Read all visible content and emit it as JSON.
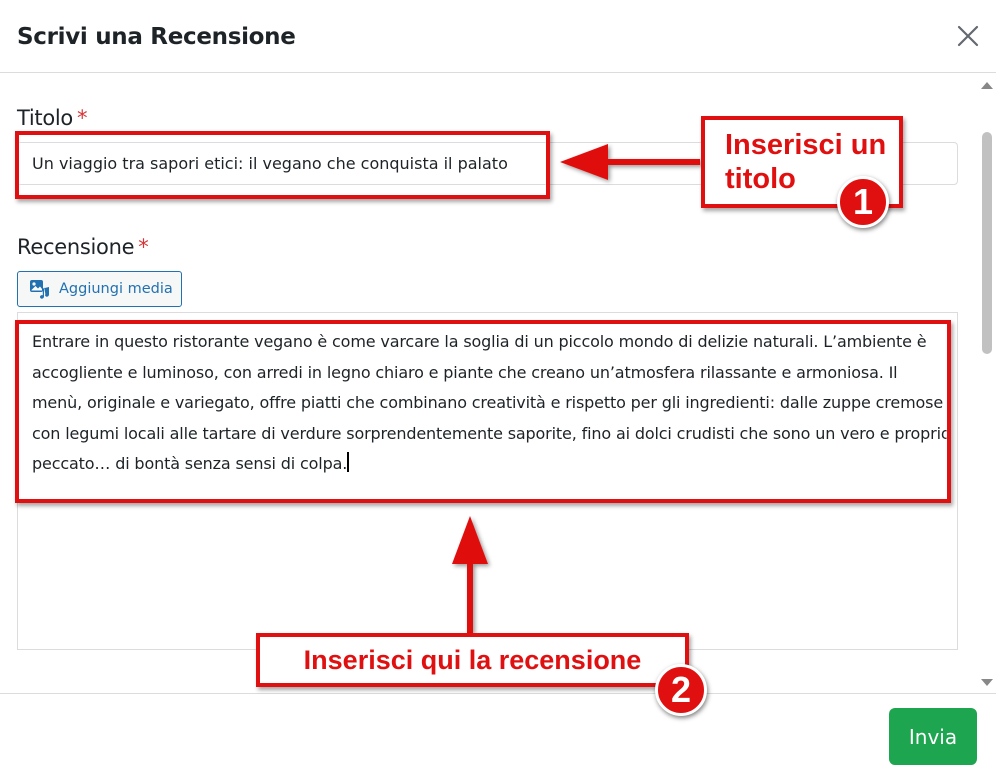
{
  "dialog": {
    "title": "Scrivi una Recensione",
    "close_icon": "close-icon"
  },
  "form": {
    "title_label": "Titolo",
    "required_mark": "*",
    "title_value": "Un viaggio tra sapori etici: il vegano che conquista il palato",
    "review_label": "Recensione",
    "add_media_label": "Aggiungi media",
    "add_media_icon": "media-icon",
    "review_text": "Entrare in questo ristorante vegano è come varcare la soglia di un piccolo mondo di delizie naturali. L’ambiente è accogliente e luminoso, con arredi in legno chiaro e piante che creano un’atmosfera rilassante e armoniosa. Il menù, originale e variegato, offre piatti che combinano creatività e rispetto per gli ingredienti: dalle zuppe cremose con legumi locali alle tartare di verdure sorprendentemente saporite, fino ai dolci crudisti che sono un vero e proprio peccato… di bontà senza sensi di colpa."
  },
  "footer": {
    "submit_label": "Invia"
  },
  "annotations": {
    "callout_1_line1": "Inserisci un",
    "callout_1_line2": "titolo",
    "badge_1": "1",
    "callout_2": "Inserisci qui la recensione",
    "badge_2": "2"
  },
  "colors": {
    "annotation_red": "#e01010",
    "submit_green": "#1ea54f",
    "link_blue": "#2271b1",
    "required_red": "#d63638"
  }
}
